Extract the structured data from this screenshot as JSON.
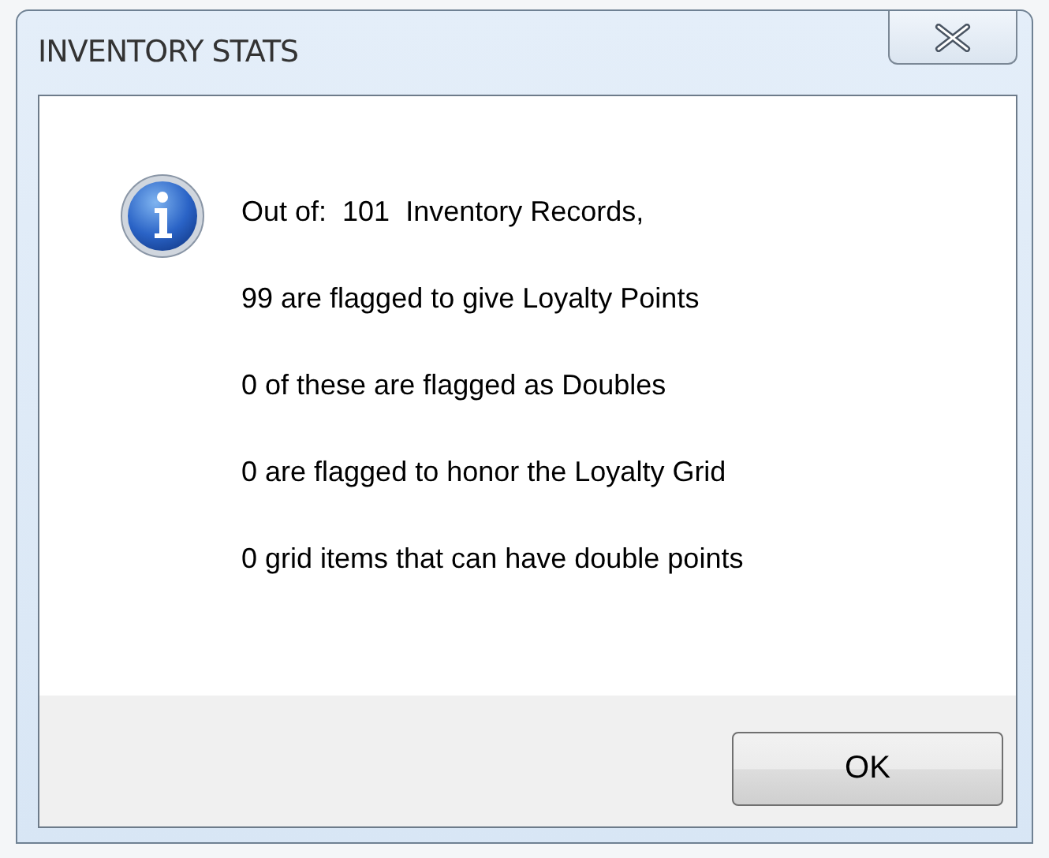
{
  "window": {
    "title": "INVENTORY STATS"
  },
  "messages": [
    "Out of:  101  Inventory Records,",
    "99 are flagged to give Loyalty Points",
    "0 of these are flagged as Doubles",
    "0 are flagged to honor the Loyalty Grid",
    "0 grid items that can have double points"
  ],
  "buttons": [
    "OK"
  ]
}
